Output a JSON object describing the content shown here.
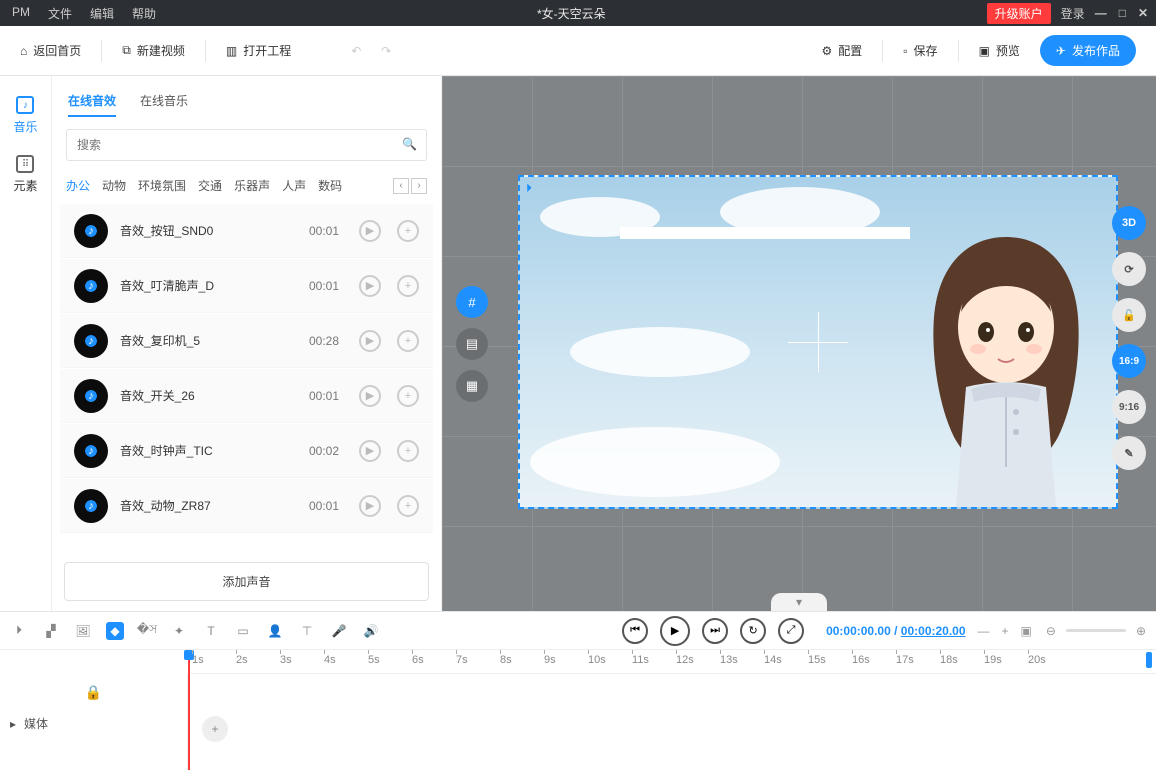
{
  "titlebar": {
    "brand": "PM",
    "menus": [
      "文件",
      "编辑",
      "帮助"
    ],
    "title": "*女-天空云朵",
    "upgrade": "升级账户",
    "login": "登录"
  },
  "toolbar": {
    "home": "返回首页",
    "newvideo": "新建视频",
    "openproj": "打开工程",
    "config": "配置",
    "save": "保存",
    "preview": "预览",
    "publish": "发布作品"
  },
  "leftnav": {
    "music": "音乐",
    "elements": "元素"
  },
  "panel": {
    "tabs": [
      "在线音效",
      "在线音乐"
    ],
    "search_placeholder": "搜索",
    "cats": [
      "办公",
      "动物",
      "环境氛围",
      "交通",
      "乐器声",
      "人声",
      "数码"
    ],
    "items": [
      {
        "name": "音效_按钮_SND0",
        "dur": "00:01"
      },
      {
        "name": "音效_叮清脆声_D",
        "dur": "00:01"
      },
      {
        "name": "音效_复印机_5",
        "dur": "00:28"
      },
      {
        "name": "音效_开关_26",
        "dur": "00:01"
      },
      {
        "name": "音效_时钟声_TIC",
        "dur": "00:02"
      },
      {
        "name": "音效_动物_ZR87",
        "dur": "00:01"
      }
    ],
    "addsound": "添加声音"
  },
  "ratios": [
    "3D",
    "⟳",
    "🔓",
    "16:9",
    "9:16",
    "✎"
  ],
  "timeline": {
    "current": "00:00:00.00",
    "sep": " / ",
    "total": "00:00:20.00",
    "ticks": [
      "1s",
      "2s",
      "3s",
      "4s",
      "5s",
      "6s",
      "7s",
      "8s",
      "9s",
      "10s",
      "11s",
      "12s",
      "13s",
      "14s",
      "15s",
      "16s",
      "17s",
      "18s",
      "19s",
      "20s"
    ],
    "media": "媒体"
  }
}
